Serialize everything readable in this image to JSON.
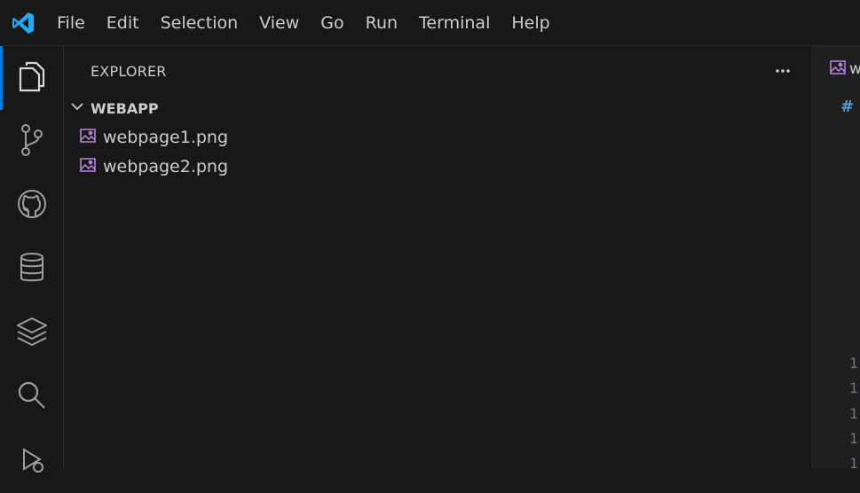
{
  "menu": [
    "File",
    "Edit",
    "Selection",
    "View",
    "Go",
    "Run",
    "Terminal",
    "Help"
  ],
  "sidebar": {
    "title": "EXPLORER",
    "folder": "WEBAPP",
    "files": [
      "webpage1.png",
      "webpage2.png"
    ]
  },
  "activity_bar": {
    "items": [
      "files-icon",
      "source-control-icon",
      "github-icon",
      "database-icon",
      "layers-icon",
      "search-icon",
      "run-debug-icon"
    ]
  },
  "editor": {
    "tab_label": "w",
    "hash": "#",
    "line_numbers": [
      "1",
      "1",
      "1",
      "1",
      "1"
    ]
  },
  "colors": {
    "accent": "#0078d4",
    "file_icon": "#b180d7",
    "logo": "#23a9f2",
    "hash": "#569cd6"
  }
}
